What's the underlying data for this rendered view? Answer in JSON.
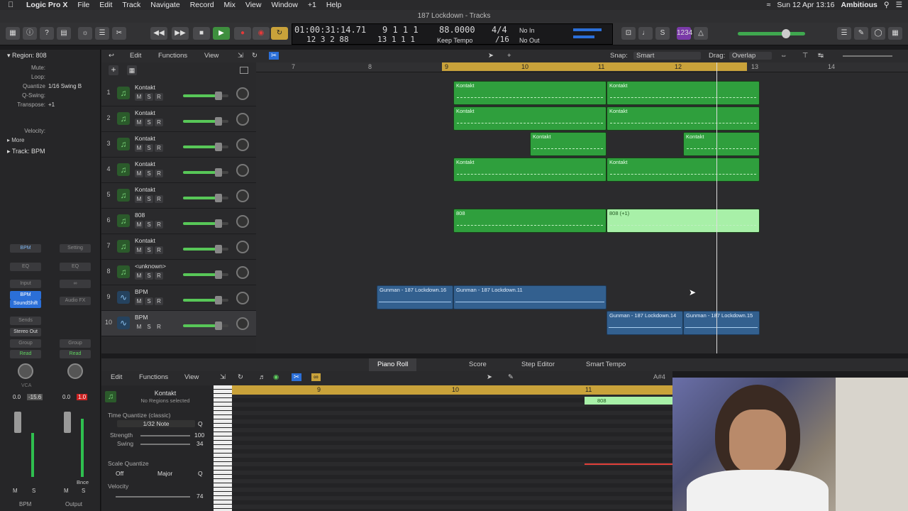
{
  "menubar": {
    "app": "Logic Pro X",
    "items": [
      "File",
      "Edit",
      "Track",
      "Navigate",
      "Record",
      "Mix",
      "View",
      "Window",
      "+1",
      "Help"
    ],
    "clock": "Sun 12 Apr 13:16",
    "user": "Ambitious"
  },
  "window": {
    "title": "187 Lockdown - Tracks"
  },
  "lcd": {
    "time": "01:00:31:14.71",
    "time_sub": "12 3 2  88",
    "bar": "9  1  1    1",
    "bar_sub": "13  1  1    1",
    "tempo": "88.0000",
    "tempo_label": "Keep Tempo",
    "sig": "4/4",
    "div": "/16",
    "in": "No In",
    "out": "No Out"
  },
  "inspector": {
    "region_title": "Region: 808",
    "rows": [
      {
        "k": "Mute:",
        "v": ""
      },
      {
        "k": "Loop:",
        "v": ""
      },
      {
        "k": "Quantize",
        "v": "1/16 Swing B"
      },
      {
        "k": "Q-Swing:",
        "v": ""
      },
      {
        "k": "Transpose:",
        "v": "+1"
      },
      {
        "k": "Velocity:",
        "v": ""
      }
    ],
    "more": "More",
    "track_title": "Track: BPM",
    "strip1": {
      "name": "BPM",
      "setting": "BPM",
      "eq": "EQ",
      "input": "Input",
      "plugin": "BPM",
      "plugin2": "SoundShift",
      "sends": "Sends",
      "output": "Stereo Out",
      "group": "Group",
      "auto": "Read",
      "vol": "0.0",
      "peak": "-15.6",
      "bottom": "BPM"
    },
    "strip2": {
      "setting": "Setting",
      "eq": "EQ",
      "fx": "Audio FX",
      "group": "Group",
      "auto": "Read",
      "vol": "0.0",
      "peak": "1.0",
      "bnce": "Bnce",
      "bottom": "Output"
    }
  },
  "tracks_header": {
    "edit": "Edit",
    "functions": "Functions",
    "view": "View",
    "snap_label": "Snap:",
    "snap": "Smart",
    "drag_label": "Drag:",
    "drag": "Overlap"
  },
  "ruler": {
    "bars": [
      "7",
      "8",
      "9",
      "10",
      "11",
      "12",
      "13",
      "14"
    ]
  },
  "tracks": [
    {
      "num": "1",
      "name": "Kontakt",
      "type": "midi",
      "vol": 0.78
    },
    {
      "num": "2",
      "name": "Kontakt",
      "type": "midi",
      "vol": 0.78
    },
    {
      "num": "3",
      "name": "Kontakt",
      "type": "midi",
      "vol": 0.78
    },
    {
      "num": "4",
      "name": "Kontakt",
      "type": "midi",
      "vol": 0.78
    },
    {
      "num": "5",
      "name": "Kontakt",
      "type": "midi",
      "vol": 0.78
    },
    {
      "num": "6",
      "name": "808",
      "type": "midi",
      "vol": 0.78
    },
    {
      "num": "7",
      "name": "Kontakt",
      "type": "midi",
      "vol": 0.78
    },
    {
      "num": "8",
      "name": "<unknown>",
      "type": "midi",
      "vol": 0.78
    },
    {
      "num": "9",
      "name": "BPM",
      "type": "audio",
      "vol": 0.78
    },
    {
      "num": "10",
      "name": "BPM",
      "type": "audio",
      "vol": 0.78
    }
  ],
  "regions": [
    {
      "lane": 0,
      "name": "Kontakt",
      "kind": "midi",
      "start": 9.0,
      "end": 11.0
    },
    {
      "lane": 0,
      "name": "Kontakt",
      "kind": "midi",
      "start": 11.0,
      "end": 13.0
    },
    {
      "lane": 1,
      "name": "Kontakt",
      "kind": "midi",
      "start": 9.0,
      "end": 11.0
    },
    {
      "lane": 1,
      "name": "Kontakt",
      "kind": "midi",
      "start": 11.0,
      "end": 13.0
    },
    {
      "lane": 2,
      "name": "Kontakt",
      "kind": "midi",
      "start": 10.0,
      "end": 11.0
    },
    {
      "lane": 2,
      "name": "Kontakt",
      "kind": "midi",
      "start": 12.0,
      "end": 13.0
    },
    {
      "lane": 3,
      "name": "Kontakt",
      "kind": "midi",
      "start": 9.0,
      "end": 11.0
    },
    {
      "lane": 3,
      "name": "Kontakt",
      "kind": "midi",
      "start": 11.0,
      "end": 13.0
    },
    {
      "lane": 5,
      "name": "808",
      "kind": "midi",
      "start": 9.0,
      "end": 11.0
    },
    {
      "lane": 5,
      "name": "808 (+1)",
      "kind": "light",
      "start": 11.0,
      "end": 13.0
    },
    {
      "lane": 8,
      "name": "Gunman - 187 Lockdown.16",
      "kind": "audio",
      "start": 8.0,
      "end": 9.0
    },
    {
      "lane": 8,
      "name": "Gunman - 187 Lockdown.11",
      "kind": "audio",
      "start": 9.0,
      "end": 11.0
    },
    {
      "lane": 9,
      "name": "Gunman - 187 Lockdown.14",
      "kind": "audio",
      "start": 11.0,
      "end": 12.0
    },
    {
      "lane": 9,
      "name": "Gunman - 187 Lockdown.15",
      "kind": "audio",
      "start": 12.0,
      "end": 13.0
    }
  ],
  "lower_tabs": [
    "Piano Roll",
    "Score",
    "Step Editor",
    "Smart Tempo"
  ],
  "piano_roll": {
    "edit": "Edit",
    "functions": "Functions",
    "view": "View",
    "track_name": "Kontakt",
    "track_sub": "No Regions selected",
    "tq_label": "Time Quantize (classic)",
    "tq_value": "1/32 Note",
    "strength_label": "Strength",
    "strength": "100",
    "swing_label": "Swing",
    "swing": "34",
    "scale_label": "Scale Quantize",
    "scale_off": "Off",
    "scale_mode": "Major",
    "velocity_label": "Velocity",
    "velocity": "74",
    "ruler": [
      "9",
      "10",
      "11"
    ],
    "region": "808",
    "note_info": "A#4"
  }
}
